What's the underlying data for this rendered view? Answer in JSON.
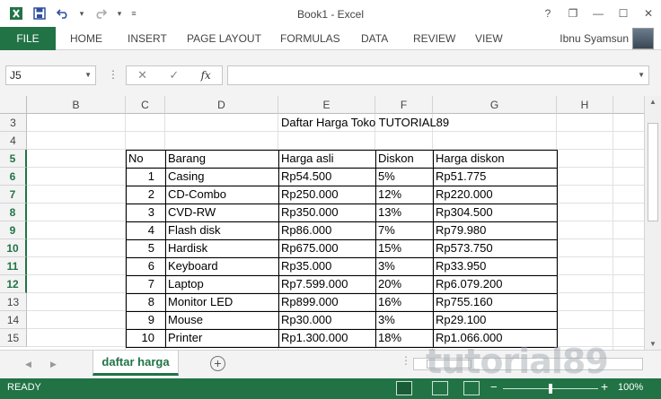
{
  "window": {
    "title": "Book1 - Excel",
    "buttons": [
      "?",
      "❐",
      "—",
      "☐",
      "✕"
    ]
  },
  "ribbon": {
    "tabs": [
      "FILE",
      "HOME",
      "INSERT",
      "PAGE LAYOUT",
      "FORMULAS",
      "DATA",
      "REVIEW",
      "VIEW"
    ],
    "user": "Ibnu Syamsun"
  },
  "formula_bar": {
    "name_box": "J5",
    "cancel_icon": "✕",
    "enter_icon": "✓",
    "fx_label": "fx",
    "formula": ""
  },
  "grid": {
    "columns": [
      "B",
      "C",
      "D",
      "E",
      "F",
      "G",
      "H"
    ],
    "rows": [
      "3",
      "4",
      "5",
      "6",
      "7",
      "8",
      "9",
      "10",
      "11",
      "12",
      "13",
      "14",
      "15"
    ],
    "title_cell": "Daftar Harga Toko TUTORIAL89",
    "table": {
      "headers": [
        "No",
        "Barang",
        "Harga asli",
        "Diskon",
        "Harga diskon"
      ],
      "rows": [
        [
          "1",
          "Casing",
          "Rp54.500",
          "5%",
          "Rp51.775"
        ],
        [
          "2",
          "CD-Combo",
          "Rp250.000",
          "12%",
          "Rp220.000"
        ],
        [
          "3",
          "CVD-RW",
          "Rp350.000",
          "13%",
          "Rp304.500"
        ],
        [
          "4",
          "Flash disk",
          "Rp86.000",
          "7%",
          "Rp79.980"
        ],
        [
          "5",
          "Hardisk",
          "Rp675.000",
          "15%",
          "Rp573.750"
        ],
        [
          "6",
          "Keyboard",
          "Rp35.000",
          "3%",
          "Rp33.950"
        ],
        [
          "7",
          "Laptop",
          "Rp7.599.000",
          "20%",
          "Rp6.079.200"
        ],
        [
          "8",
          "Monitor LED",
          "Rp899.000",
          "16%",
          "Rp755.160"
        ],
        [
          "9",
          "Mouse",
          "Rp30.000",
          "3%",
          "Rp29.100"
        ],
        [
          "10",
          "Printer",
          "Rp1.300.000",
          "18%",
          "Rp1.066.000"
        ]
      ]
    }
  },
  "sheets": {
    "active": "daftar harga",
    "add_label": "+"
  },
  "watermark": "tutorial89",
  "status": {
    "text": "READY",
    "zoom": "100%",
    "zoom_minus": "−",
    "zoom_plus": "+"
  },
  "colors": {
    "accent": "#217346",
    "accent_dark": "#1a5c38"
  }
}
